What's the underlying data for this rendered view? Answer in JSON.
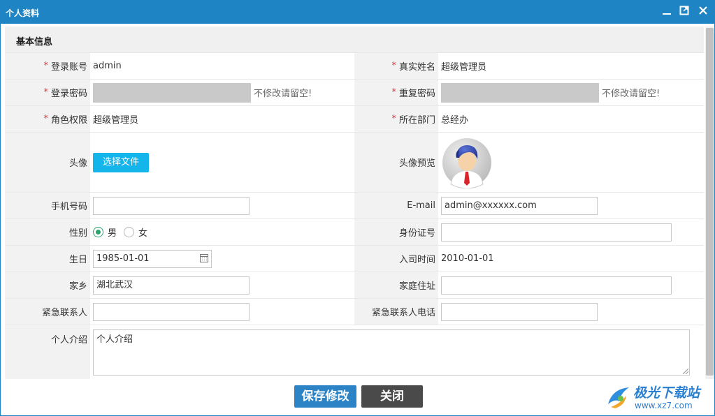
{
  "window": {
    "title": "个人资料"
  },
  "section": {
    "title": "基本信息"
  },
  "fields": {
    "login_account": {
      "label": "登录账号",
      "value": "admin"
    },
    "real_name": {
      "label": "真实姓名",
      "value": "超级管理员"
    },
    "login_password": {
      "label": "登录密码",
      "hint": "不修改请留空!"
    },
    "repeat_password": {
      "label": "重复密码",
      "hint": "不修改请留空!"
    },
    "role": {
      "label": "角色权限",
      "value": "超级管理员"
    },
    "department": {
      "label": "所在部门",
      "value": "总经办"
    },
    "avatar": {
      "label": "头像",
      "button": "选择文件"
    },
    "avatar_preview": {
      "label": "头像预览"
    },
    "phone": {
      "label": "手机号码",
      "value": ""
    },
    "email": {
      "label": "E-mail",
      "value": "admin@xxxxxx.com"
    },
    "gender": {
      "label": "性别",
      "options": [
        "男",
        "女"
      ],
      "selected": "男"
    },
    "id_number": {
      "label": "身份证号",
      "value": ""
    },
    "birthday": {
      "label": "生日",
      "value": "1985-01-01"
    },
    "join_date": {
      "label": "入司时间",
      "value": "2010-01-01"
    },
    "hometown": {
      "label": "家乡",
      "value": "湖北武汉"
    },
    "address": {
      "label": "家庭住址",
      "value": ""
    },
    "emergency_contact": {
      "label": "紧急联系人",
      "value": ""
    },
    "emergency_phone": {
      "label": "紧急联系人电话",
      "value": ""
    },
    "intro": {
      "label": "个人介绍",
      "value": "个人介绍"
    }
  },
  "required_mark": "*",
  "buttons": {
    "save": "保存修改",
    "close": "关闭"
  },
  "watermark": {
    "name": "极光下载站",
    "url": "www.xz7.com"
  },
  "colors": {
    "titlebar": "#1f84c4",
    "required": "#e0393e",
    "file_button": "#13b5ea",
    "save_button": "#2c84c6",
    "close_button": "#4a4a4a"
  }
}
